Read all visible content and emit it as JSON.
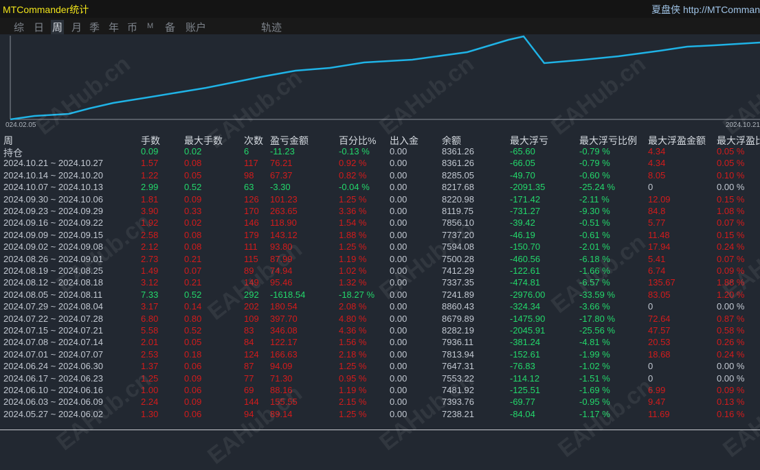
{
  "header": {
    "title": "MTCommander统计",
    "brand": "夏盘侠 http://MTComman"
  },
  "tabs": [
    {
      "label": "综",
      "active": false
    },
    {
      "label": "日",
      "active": false
    },
    {
      "label": "周",
      "active": true
    },
    {
      "label": "月",
      "active": false
    },
    {
      "label": "季",
      "active": false
    },
    {
      "label": "年",
      "active": false
    },
    {
      "label": "币",
      "active": false
    },
    {
      "label": "M",
      "active": false
    },
    {
      "label": "备",
      "active": false
    },
    {
      "label": "账户",
      "active": false
    },
    {
      "label": "轨迹",
      "active": false
    }
  ],
  "chart": {
    "start_label": "024.02.05",
    "end_label": "2024.10.21",
    "line_color": "#1fb3e6"
  },
  "watermark": "EAHub.cn",
  "colors": {
    "red": "#d41b1b",
    "green": "#23d86b",
    "grey": "#c3c9d2"
  },
  "table": {
    "columns": [
      "周",
      "手数",
      "最大手数",
      "次数",
      "盈亏金额",
      "百分比%",
      "出入金",
      "余额",
      "最大浮亏",
      "最大浮亏比例",
      "最大浮盈金额",
      "最大浮盈比"
    ],
    "rows": [
      [
        "持仓",
        "0.09",
        "0.02",
        "6",
        "-11.23",
        "-0.13 %",
        "0.00",
        "8361.26",
        "-65.60",
        "-0.79 %",
        "4.34",
        "0.05 %"
      ],
      [
        "2024.10.21 ~ 2024.10.27",
        "1.57",
        "0.08",
        "117",
        "76.21",
        "0.92 %",
        "0.00",
        "8361.26",
        "-66.05",
        "-0.79 %",
        "4.34",
        "0.05 %"
      ],
      [
        "2024.10.14 ~ 2024.10.20",
        "1.22",
        "0.05",
        "98",
        "67.37",
        "0.82 %",
        "0.00",
        "8285.05",
        "-49.70",
        "-0.60 %",
        "8.05",
        "0.10 %"
      ],
      [
        "2024.10.07 ~ 2024.10.13",
        "2.99",
        "0.52",
        "63",
        "-3.30",
        "-0.04 %",
        "0.00",
        "8217.68",
        "-2091.35",
        "-25.24 %",
        "0",
        "0.00 %"
      ],
      [
        "2024.09.30 ~ 2024.10.06",
        "1.81",
        "0.09",
        "126",
        "101.23",
        "1.25 %",
        "0.00",
        "8220.98",
        "-171.42",
        "-2.11 %",
        "12.09",
        "0.15 %"
      ],
      [
        "2024.09.23 ~ 2024.09.29",
        "3.90",
        "0.33",
        "170",
        "263.65",
        "3.36 %",
        "0.00",
        "8119.75",
        "-731.27",
        "-9.30 %",
        "84.8",
        "1.08 %"
      ],
      [
        "2024.09.16 ~ 2024.09.22",
        "1.92",
        "0.02",
        "146",
        "118.90",
        "1.54 %",
        "0.00",
        "7856.10",
        "-39.42",
        "-0.51 %",
        "5.77",
        "0.07 %"
      ],
      [
        "2024.09.09 ~ 2024.09.15",
        "2.58",
        "0.08",
        "179",
        "143.12",
        "1.88 %",
        "0.00",
        "7737.20",
        "-46.19",
        "-0.61 %",
        "11.48",
        "0.15 %"
      ],
      [
        "2024.09.02 ~ 2024.09.08",
        "2.12",
        "0.08",
        "111",
        "93.80",
        "1.25 %",
        "0.00",
        "7594.08",
        "-150.70",
        "-2.01 %",
        "17.94",
        "0.24 %"
      ],
      [
        "2024.08.26 ~ 2024.09.01",
        "2.73",
        "0.21",
        "115",
        "87.99",
        "1.19 %",
        "0.00",
        "7500.28",
        "-460.56",
        "-6.18 %",
        "5.41",
        "0.07 %"
      ],
      [
        "2024.08.19 ~ 2024.08.25",
        "1.49",
        "0.07",
        "89",
        "74.94",
        "1.02 %",
        "0.00",
        "7412.29",
        "-122.61",
        "-1.66 %",
        "6.74",
        "0.09 %"
      ],
      [
        "2024.08.12 ~ 2024.08.18",
        "3.12",
        "0.21",
        "149",
        "95.46",
        "1.32 %",
        "0.00",
        "7337.35",
        "-474.81",
        "-6.57 %",
        "135.67",
        "1.88 %"
      ],
      [
        "2024.08.05 ~ 2024.08.11",
        "7.33",
        "0.52",
        "292",
        "-1618.54",
        "-18.27 %",
        "0.00",
        "7241.89",
        "-2976.00",
        "-33.59 %",
        "83.05",
        "1.20 %"
      ],
      [
        "2024.07.29 ~ 2024.08.04",
        "3.17",
        "0.14",
        "202",
        "180.54",
        "2.08 %",
        "0.00",
        "8860.43",
        "-324.34",
        "-3.66 %",
        "0",
        "0.00 %"
      ],
      [
        "2024.07.22 ~ 2024.07.28",
        "6.80",
        "0.80",
        "109",
        "397.70",
        "4.80 %",
        "0.00",
        "8679.89",
        "-1475.90",
        "-17.80 %",
        "72.64",
        "0.87 %"
      ],
      [
        "2024.07.15 ~ 2024.07.21",
        "5.58",
        "0.52",
        "83",
        "346.08",
        "4.36 %",
        "0.00",
        "8282.19",
        "-2045.91",
        "-25.56 %",
        "47.57",
        "0.58 %"
      ],
      [
        "2024.07.08 ~ 2024.07.14",
        "2.01",
        "0.05",
        "84",
        "122.17",
        "1.56 %",
        "0.00",
        "7936.11",
        "-381.24",
        "-4.81 %",
        "20.53",
        "0.26 %"
      ],
      [
        "2024.07.01 ~ 2024.07.07",
        "2.53",
        "0.18",
        "124",
        "166.63",
        "2.18 %",
        "0.00",
        "7813.94",
        "-152.61",
        "-1.99 %",
        "18.68",
        "0.24 %"
      ],
      [
        "2024.06.24 ~ 2024.06.30",
        "1.37",
        "0.06",
        "87",
        "94.09",
        "1.25 %",
        "0.00",
        "7647.31",
        "-76.83",
        "-1.02 %",
        "0",
        "0.00 %"
      ],
      [
        "2024.06.17 ~ 2024.06.23",
        "1.25",
        "0.09",
        "77",
        "71.30",
        "0.95 %",
        "0.00",
        "7553.22",
        "-114.12",
        "-1.51 %",
        "0",
        "0.00 %"
      ],
      [
        "2024.06.10 ~ 2024.06.16",
        "1.00",
        "0.06",
        "69",
        "88.16",
        "1.19 %",
        "0.00",
        "7481.92",
        "-125.51",
        "-1.69 %",
        "6.99",
        "0.09 %"
      ],
      [
        "2024.06.03 ~ 2024.06.09",
        "2.24",
        "0.09",
        "144",
        "155.55",
        "2.15 %",
        "0.00",
        "7393.76",
        "-69.77",
        "-0.95 %",
        "9.47",
        "0.13 %"
      ],
      [
        "2024.05.27 ~ 2024.06.02",
        "1.30",
        "0.06",
        "94",
        "89.14",
        "1.25 %",
        "0.00",
        "7238.21",
        "-84.04",
        "-1.17 %",
        "11.69",
        "0.16 %"
      ]
    ]
  }
}
